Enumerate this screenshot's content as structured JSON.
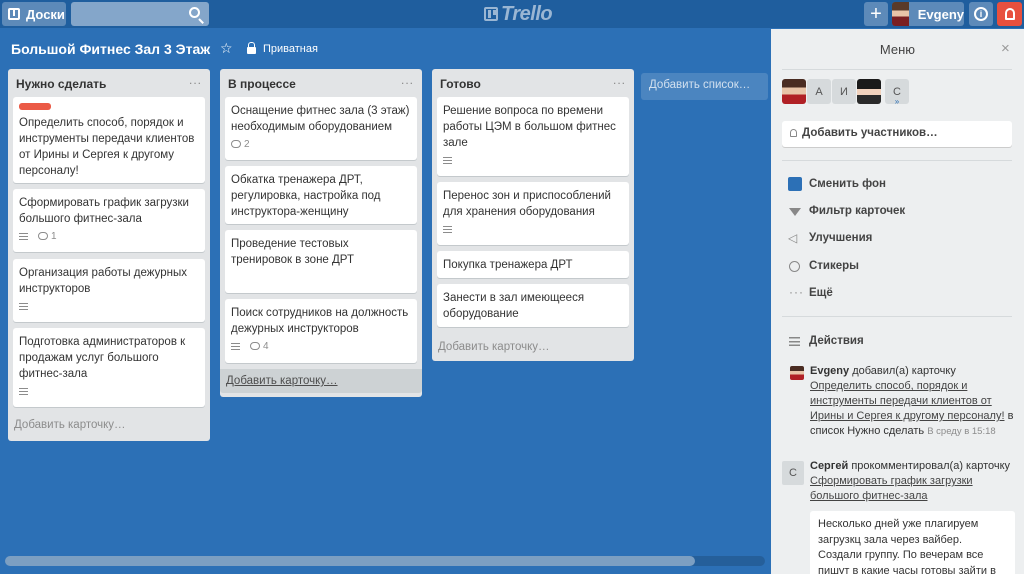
{
  "header": {
    "boards_label": "Доски",
    "search_value": "",
    "logo_text": "Trello",
    "plus_label": "+",
    "user_name": "Evgeny",
    "info_label": "i"
  },
  "board": {
    "title": "Большой Фитнес Зал 3 Этаж",
    "visibility": "Приватная"
  },
  "lists": [
    {
      "title": "Нужно сделать",
      "menu": "...",
      "cards": [
        {
          "text": "Определить способ, порядок и инструменты передачи клиентов от Ирины и Сергея к другому персоналу!",
          "label_color": "#eb5a46"
        },
        {
          "text": "Сформировать график загрузки большого фитнес-зала",
          "comments": "1"
        },
        {
          "text": "Организация работы дежурных инструкторов"
        },
        {
          "text": "Подготовка администраторов к продажам услуг большого фитнес-зала"
        }
      ],
      "add_card": "Добавить карточку…"
    },
    {
      "title": "В процессе",
      "menu": "...",
      "cards": [
        {
          "text": "Оснащение фитнес зала (3 этаж) необходимым оборудованием",
          "comments": "2"
        },
        {
          "text": "Обкатка тренажера ДРТ, регулировка, настройка под инструктора-женщину"
        },
        {
          "text": "Проведение тестовых тренировок в зоне ДРТ"
        },
        {
          "text": "Поиск сотрудников на должность дежурных инструкторов",
          "comments": "4"
        }
      ],
      "add_card": "Добавить карточку…"
    },
    {
      "title": "Готово",
      "menu": "...",
      "cards": [
        {
          "text": "Решение вопроса по времени работы ЦЭМ в большом фитнес зале"
        },
        {
          "text": "Перенос зон и приспособлений для хранения оборудования"
        },
        {
          "text": "Покупка тренажера ДРТ"
        },
        {
          "text": "Занести в зал имеющееся оборудование"
        }
      ],
      "add_card": "Добавить карточку…"
    }
  ],
  "add_list": "Добавить список…",
  "menu": {
    "title": "Меню",
    "close": "×",
    "members": [
      "А",
      "И",
      "С"
    ],
    "add_members": "Добавить участников…",
    "items": {
      "change_bg": "Сменить фон",
      "filter": "Фильтр карточек",
      "powerups": "Улучшения",
      "stickers": "Стикеры",
      "more": "Ещё"
    },
    "activity_title": "Действия",
    "activity": [
      {
        "user": "Evgeny",
        "action": "добавил(а) карточку",
        "card": "Определить способ, порядок и инструменты передачи клиентов от Ирины и Сергея к другому персоналу!",
        "suffix": "в список Нужно сделать",
        "time": "В среду в 15:18"
      },
      {
        "avatar": "С",
        "user": "Сергей",
        "action": "прокомментировал(а) карточку",
        "card": "Сформировать график загрузки большого фитнес-зала",
        "comment": "Несколько дней уже плагируем загрузкц зала через вайбер. Создали группу. По вечерам все пишут в какие часы готовы зайти в"
      }
    ]
  }
}
